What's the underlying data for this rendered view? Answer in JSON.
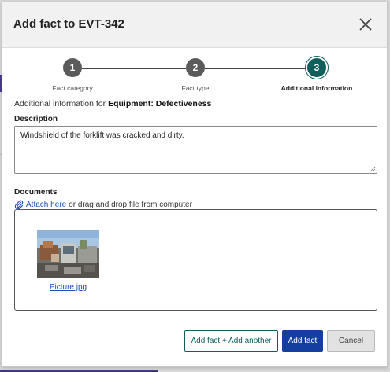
{
  "dialog": {
    "title": "Add fact to EVT-342",
    "close_icon": "close-x-icon"
  },
  "stepper": {
    "steps": [
      {
        "number": "1",
        "label": "Fact category",
        "state": "completed"
      },
      {
        "number": "2",
        "label": "Fact type",
        "state": "completed"
      },
      {
        "number": "3",
        "label": "Additional information",
        "state": "active"
      }
    ]
  },
  "context": {
    "prefix": "Additional information for",
    "subject": "Equipment: Defectiveness"
  },
  "description": {
    "label": "Description",
    "value": "Windshield of the forklift was cracked and dirty."
  },
  "documents": {
    "label": "Documents",
    "attach_icon": "paperclip-icon",
    "attach_link": "Attach here",
    "attach_hint": "or drag and drop file from computer",
    "files": [
      {
        "name": "Picture.jpg"
      }
    ]
  },
  "actions": {
    "add_another": "Add fact + Add another",
    "add_fact": "Add fact",
    "cancel": "Cancel"
  },
  "colors": {
    "primary": "#143fa0",
    "teal": "#0f5f5a",
    "step_inactive": "#5b5b5b",
    "link": "#1a4fb8"
  }
}
